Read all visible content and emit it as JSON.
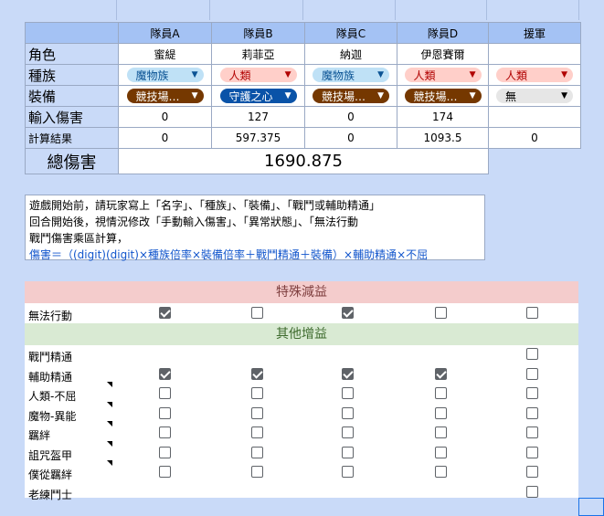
{
  "header": {
    "members": [
      "隊員A",
      "隊員B",
      "隊員C",
      "隊員D",
      "援軍"
    ]
  },
  "rows": {
    "role": {
      "label": "角色",
      "values": [
        "蜜緹",
        "莉菲亞",
        "納迦",
        "伊恩賽爾",
        ""
      ]
    },
    "race": {
      "label": "種族",
      "values": [
        "魔物族",
        "人類",
        "魔物族",
        "人類",
        "人類"
      ]
    },
    "equip": {
      "label": "裝備",
      "values": [
        "競技場…",
        "守護之心",
        "競技場…",
        "競技場…",
        "無"
      ]
    },
    "input": {
      "label": "輸入傷害",
      "values": [
        "0",
        "127",
        "0",
        "174",
        ""
      ]
    },
    "result": {
      "label": "計算結果",
      "values": [
        "0",
        "597.375",
        "0",
        "1093.5",
        "0"
      ]
    }
  },
  "total": {
    "label": "總傷害",
    "value": "1690.875"
  },
  "note": {
    "line1": "遊戲開始前，請玩家寫上「名字」、「種族」、「裝備」、「戰鬥或輔助精通」",
    "line2": "回合開始後，視情況修改「手動輸入傷害」、「異常狀態」、「無法行動",
    "line3": "戰鬥傷害乘區計算，",
    "line4": "傷害＝（(digit)(digit)×種族倍率×裝備倍率＋戰鬥精通＋裝備）×輔助精通×不屈"
  },
  "special": {
    "title": "特殊減益",
    "rows": [
      {
        "label": "無法行動",
        "checks": [
          true,
          false,
          true,
          false,
          false
        ]
      }
    ]
  },
  "other": {
    "title": "其他增益",
    "rows": [
      {
        "label": "戰鬥精通",
        "checks": [
          null,
          null,
          null,
          null,
          false
        ]
      },
      {
        "label": "輔助精通",
        "checks": [
          true,
          true,
          true,
          true,
          false
        ]
      },
      {
        "label": "人類-不屈",
        "checks": [
          false,
          false,
          false,
          false,
          false
        ]
      },
      {
        "label": "魔物-異能",
        "checks": [
          false,
          false,
          false,
          false,
          false
        ]
      },
      {
        "label": "羈絆",
        "checks": [
          false,
          false,
          false,
          false,
          false
        ]
      },
      {
        "label": "詛咒盔甲",
        "checks": [
          false,
          false,
          false,
          false,
          false
        ]
      },
      {
        "label": "僕從羈絆",
        "checks": [
          false,
          false,
          false,
          false,
          false
        ]
      },
      {
        "label": "老練鬥士",
        "checks": [
          null,
          null,
          null,
          null,
          false
        ]
      }
    ]
  },
  "colors": {
    "header": "#a4c2f4",
    "background": "#c9daf8",
    "chipBlue": "#bfe1f6",
    "chipRed": "#ffcfc9",
    "chipBrown": "#753800",
    "chipNavy": "#0a53a8"
  }
}
